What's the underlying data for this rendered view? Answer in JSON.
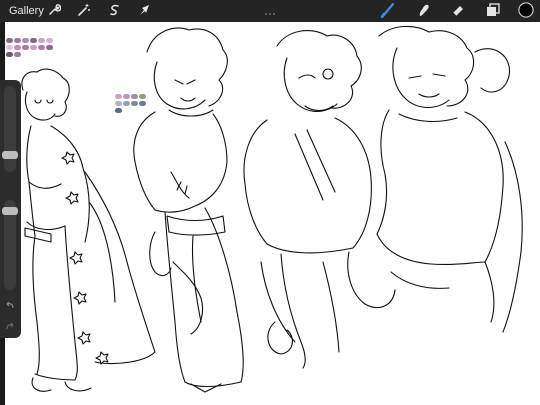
{
  "topbar": {
    "gallery_label": "Gallery",
    "left_tools": [
      "wrench-icon",
      "magic-wand-icon",
      "selection-icon",
      "transform-arrow-icon"
    ],
    "right_tools": [
      "brush-icon",
      "smudge-icon",
      "eraser-icon",
      "layers-icon",
      "color-icon"
    ],
    "active_tool": "brush-icon",
    "active_color": "#000000",
    "accent": "#3a8ee6"
  },
  "palette_a": [
    "#8a6a86",
    "#9b7aa0",
    "#b48bb0",
    "#7e6a8a",
    "#c9a6c4",
    "#d8b4d1",
    "#e3c3dd",
    "#c28bb8",
    "#a77aa5",
    "#d19dc7",
    "#b07baa",
    "#8c6990",
    "#6d5a75",
    "#9a7c9c"
  ],
  "palette_b": [
    "#c7a5c7",
    "#b69bb9",
    "#a48ba8",
    "#8fa17f",
    "#b4b0c2",
    "#96a0b8",
    "#7f8aa8",
    "#6c7a96",
    "#5b6b86"
  ]
}
